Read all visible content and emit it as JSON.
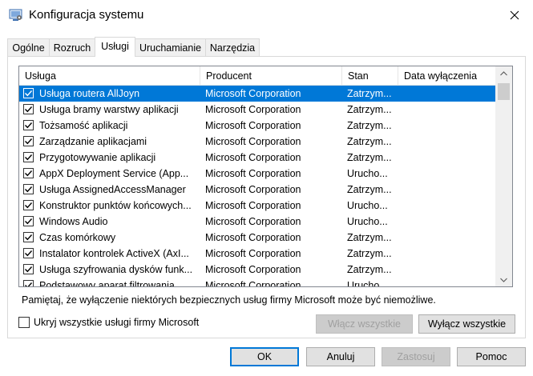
{
  "window": {
    "title": "Konfiguracja systemu"
  },
  "tabs": [
    {
      "label": "Ogólne"
    },
    {
      "label": "Rozruch"
    },
    {
      "label": "Usługi"
    },
    {
      "label": "Uruchamianie"
    },
    {
      "label": "Narzędzia"
    }
  ],
  "active_tab": "Usługi",
  "columns": {
    "service": "Usługa",
    "manufacturer": "Producent",
    "status": "Stan",
    "disabled_date": "Data wyłączenia"
  },
  "services": [
    {
      "name": "Usługa routera AllJoyn",
      "manufacturer": "Microsoft Corporation",
      "status": "Zatrzym...",
      "checked": true,
      "selected": true
    },
    {
      "name": "Usługa bramy warstwy aplikacji",
      "manufacturer": "Microsoft Corporation",
      "status": "Zatrzym...",
      "checked": true
    },
    {
      "name": "Tożsamość aplikacji",
      "manufacturer": "Microsoft Corporation",
      "status": "Zatrzym...",
      "checked": true
    },
    {
      "name": "Zarządzanie aplikacjami",
      "manufacturer": "Microsoft Corporation",
      "status": "Zatrzym...",
      "checked": true
    },
    {
      "name": "Przygotowywanie aplikacji",
      "manufacturer": "Microsoft Corporation",
      "status": "Zatrzym...",
      "checked": true
    },
    {
      "name": "AppX Deployment Service (App...",
      "manufacturer": "Microsoft Corporation",
      "status": "Urucho...",
      "checked": true
    },
    {
      "name": "Usługa AssignedAccessManager",
      "manufacturer": "Microsoft Corporation",
      "status": "Zatrzym...",
      "checked": true
    },
    {
      "name": "Konstruktor punktów końcowych...",
      "manufacturer": "Microsoft Corporation",
      "status": "Urucho...",
      "checked": true
    },
    {
      "name": "Windows Audio",
      "manufacturer": "Microsoft Corporation",
      "status": "Urucho...",
      "checked": true
    },
    {
      "name": "Czas komórkowy",
      "manufacturer": "Microsoft Corporation",
      "status": "Zatrzym...",
      "checked": true
    },
    {
      "name": "Instalator kontrolek ActiveX (AxI...",
      "manufacturer": "Microsoft Corporation",
      "status": "Zatrzym...",
      "checked": true
    },
    {
      "name": "Usługa szyfrowania dysków funk...",
      "manufacturer": "Microsoft Corporation",
      "status": "Zatrzym...",
      "checked": true
    },
    {
      "name": "Podstawowy aparat filtrowania",
      "manufacturer": "Microsoft Corporation",
      "status": "Urucho...",
      "checked": true
    }
  ],
  "note": "Pamiętaj, że wyłączenie niektórych bezpiecznych usług firmy Microsoft może być niemożliwe.",
  "hide_ms_label": "Ukryj wszystkie usługi firmy Microsoft",
  "buttons": {
    "enable_all": "Włącz wszystkie",
    "disable_all": "Wyłącz wszystkie",
    "ok": "OK",
    "cancel": "Anuluj",
    "apply": "Zastosuj",
    "help": "Pomoc"
  },
  "colors": {
    "selection": "#0078d7",
    "disabled_text": "#a0a0a0"
  },
  "icons": {
    "app": "msconfig-icon",
    "close": "close-icon",
    "scroll_up": "chevron-up-icon",
    "scroll_down": "chevron-down-icon",
    "check": "checkmark-icon"
  }
}
